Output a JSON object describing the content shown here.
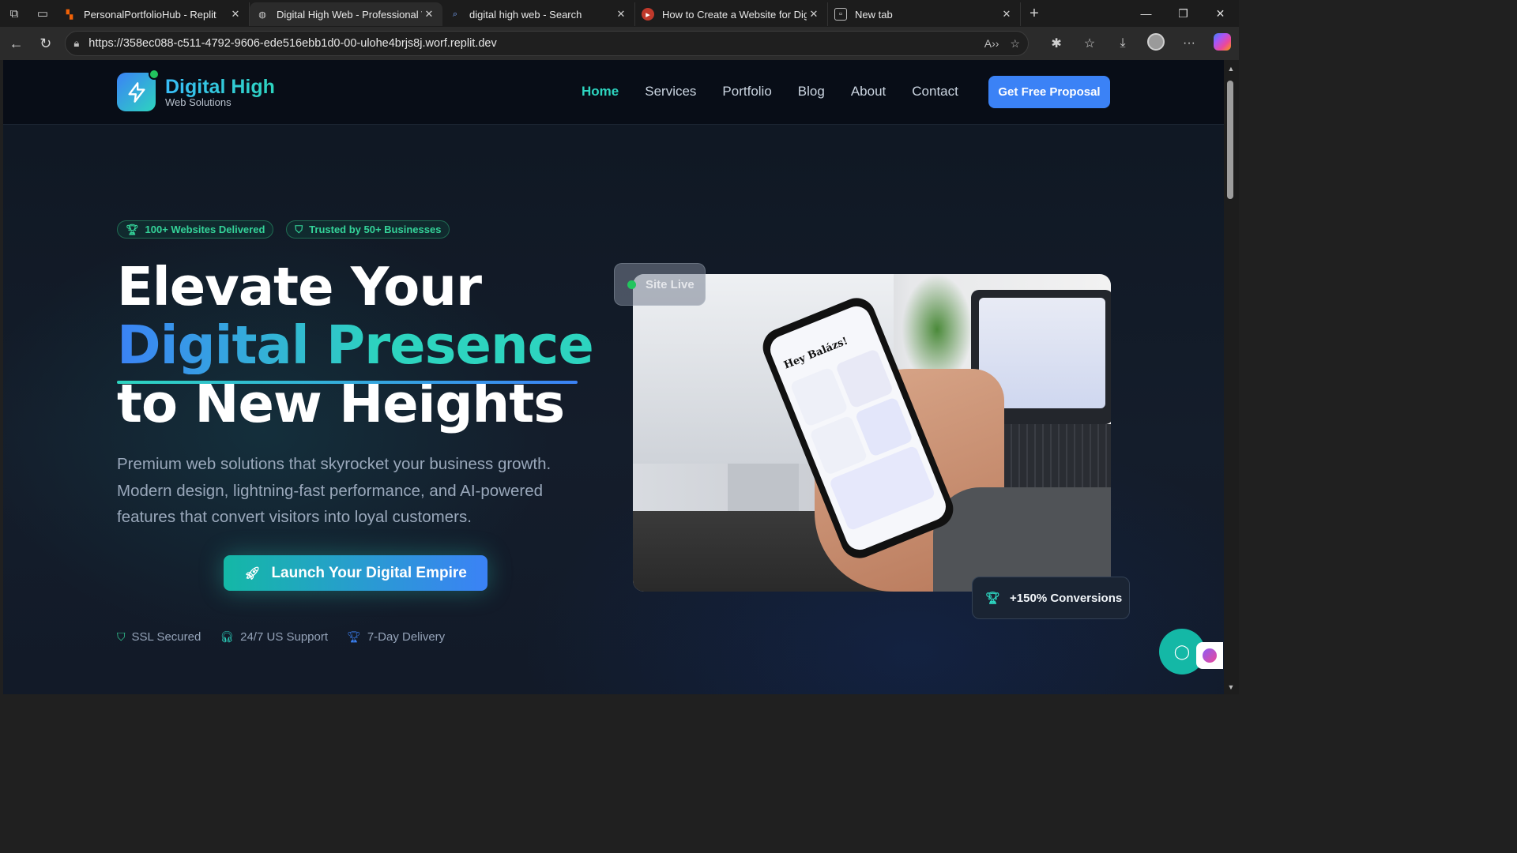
{
  "browser": {
    "tabs": [
      {
        "title": "PersonalPortfolioHub - Replit",
        "active": false,
        "favicon_icon": "replit-icon"
      },
      {
        "title": "Digital High Web - Professional W",
        "active": true,
        "favicon_icon": "globe-icon"
      },
      {
        "title": "digital high web - Search",
        "active": false,
        "favicon_icon": "search-icon"
      },
      {
        "title": "How to Create a Website for Digit",
        "active": false,
        "favicon_icon": "youtube-icon"
      },
      {
        "title": "New tab",
        "active": false,
        "favicon_icon": "newtab-icon"
      }
    ],
    "url": "https://358ec088-c511-4792-9606-ede516ebb1d0-00-ulohe4brjs8j.worf.replit.dev"
  },
  "site": {
    "logo": {
      "title": "Digital High",
      "subtitle": "Web Solutions",
      "icon": "lightning-icon"
    },
    "nav": {
      "items": [
        "Home",
        "Services",
        "Portfolio",
        "Blog",
        "About",
        "Contact"
      ],
      "active": "Home",
      "cta": "Get Free Proposal"
    },
    "hero": {
      "badges": [
        {
          "label": "100+ Websites Delivered",
          "icon": "trophy-icon"
        },
        {
          "label": "Trusted by 50+ Businesses",
          "icon": "shield-icon"
        }
      ],
      "headline": {
        "line1": "Elevate Your",
        "line2": "Digital Presence",
        "line3": "to New Heights"
      },
      "lead": "Premium web solutions that skyrocket your business growth. Modern design, lightning-fast performance, and AI-powered features that convert visitors into loyal customers.",
      "cta": {
        "label": "Launch Your Digital Empire",
        "icon": "rocket-icon"
      },
      "trust": [
        {
          "label": "SSL Secured",
          "icon": "shield-icon"
        },
        {
          "label": "24/7 US Support",
          "icon": "headphones-icon"
        },
        {
          "label": "7-Day Delivery",
          "icon": "trophy-icon"
        }
      ],
      "status_chip": {
        "label": "Site Live"
      },
      "stat_chip": {
        "label": "+150% Conversions",
        "icon": "trophy-icon"
      },
      "photo_text": {
        "greeting": "Hey Balázs!"
      }
    }
  },
  "colors": {
    "accent_teal": "#2dd4bf",
    "accent_blue": "#3b82f6",
    "status_green": "#22c55e",
    "background": "#0f1722"
  }
}
